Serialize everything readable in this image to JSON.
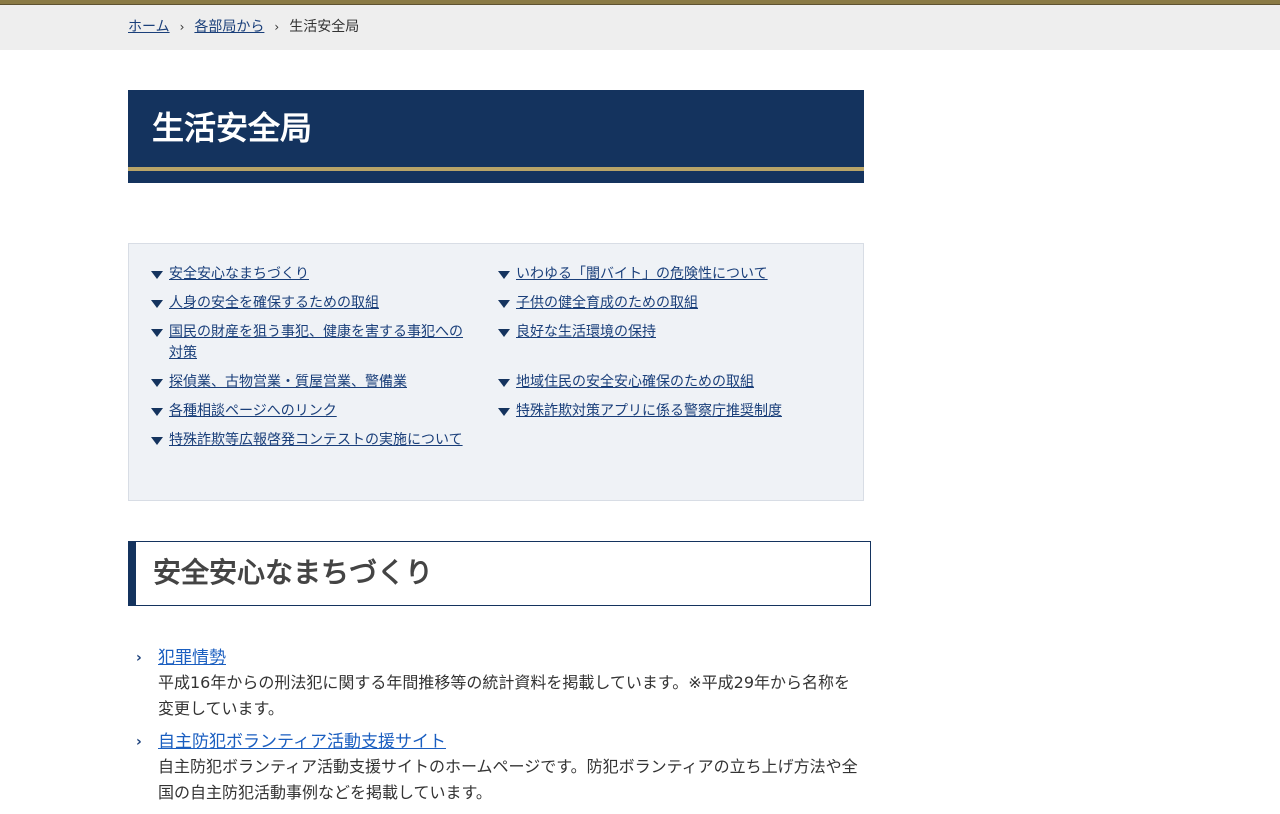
{
  "breadcrumb": {
    "home": "ホーム",
    "parent": "各部局から",
    "current": "生活安全局",
    "separator": "›"
  },
  "page_title": "生活安全局",
  "toc": {
    "left": [
      {
        "label": "安全安心なまちづくり"
      },
      {
        "label": "人身の安全を確保するための取組"
      },
      {
        "label": "国民の財産を狙う事犯、健康を害する事犯への対策"
      },
      {
        "label": "探偵業、古物営業・質屋営業、警備業"
      },
      {
        "label": "各種相談ページへのリンク"
      },
      {
        "label": "特殊詐欺等広報啓発コンテストの実施について"
      }
    ],
    "right": [
      {
        "label": "いわゆる「闇バイト」の危険性について"
      },
      {
        "label": "子供の健全育成のための取組"
      },
      {
        "label": "良好な生活環境の保持"
      },
      {
        "label": "地域住民の安全安心確保のための取組"
      },
      {
        "label": "特殊詐欺対策アプリに係る警察庁推奨制度"
      }
    ]
  },
  "section": {
    "title": "安全安心なまちづくり",
    "links": [
      {
        "label": "犯罪情勢",
        "description": "平成16年からの刑法犯に関する年間推移等の統計資料を掲載しています。※平成29年から名称を変更しています。"
      },
      {
        "label": "自主防犯ボランティア活動支援サイト",
        "description": "自主防犯ボランティア活動支援サイトのホームページです。防犯ボランティアの立ち上げ方法や全国の自主防犯活動事例などを掲載しています。"
      }
    ]
  },
  "icons": {
    "toc_marker": "triangle-down-icon",
    "link_marker": "chevron-right-icon"
  },
  "colors": {
    "navy": "#14335e",
    "gold": "#b8a468",
    "link": "#1a5ec0",
    "toc_bg": "#eff2f6"
  }
}
